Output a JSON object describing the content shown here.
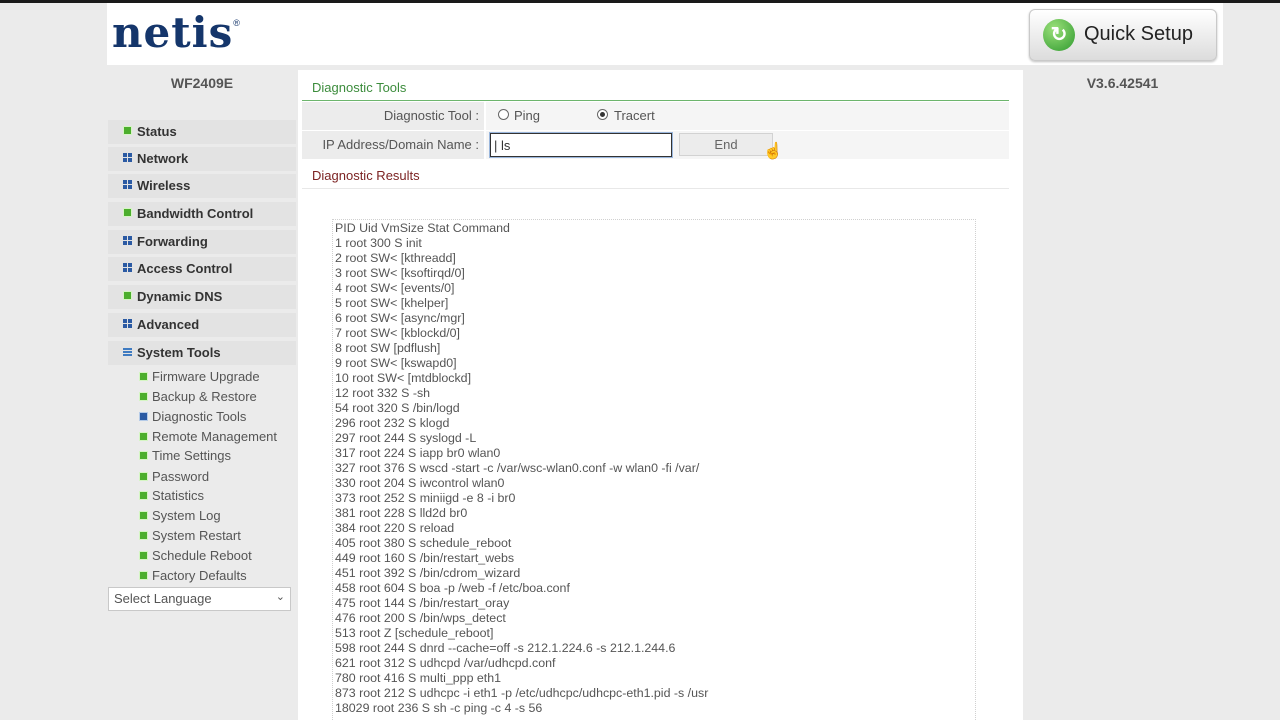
{
  "header": {
    "logo_text": "netis",
    "logo_mark": "®",
    "quick_setup_label": "Quick Setup",
    "quick_setup_icon": "refresh-arrow-icon"
  },
  "sidebar": {
    "model": "WF2409E",
    "nav_items": [
      {
        "label": "Status",
        "icon": "green-square-icon"
      },
      {
        "label": "Network",
        "icon": "grid-icon"
      },
      {
        "label": "Wireless",
        "icon": "grid-icon"
      },
      {
        "label": "Bandwidth Control",
        "icon": "green-square-icon"
      },
      {
        "label": "Forwarding",
        "icon": "grid-icon"
      },
      {
        "label": "Access Control",
        "icon": "grid-icon"
      },
      {
        "label": "Dynamic DNS",
        "icon": "green-square-icon"
      },
      {
        "label": "Advanced",
        "icon": "grid-icon"
      },
      {
        "label": "System Tools",
        "icon": "lines-icon",
        "expanded": true
      }
    ],
    "sub_items": [
      {
        "label": "Firmware Upgrade",
        "active": false
      },
      {
        "label": "Backup & Restore",
        "active": false
      },
      {
        "label": "Diagnostic Tools",
        "active": true
      },
      {
        "label": "Remote Management",
        "active": false
      },
      {
        "label": "Time Settings",
        "active": false
      },
      {
        "label": "Password",
        "active": false
      },
      {
        "label": "Statistics",
        "active": false
      },
      {
        "label": "System Log",
        "active": false
      },
      {
        "label": "System Restart",
        "active": false
      },
      {
        "label": "Schedule Reboot",
        "active": false
      },
      {
        "label": "Factory Defaults",
        "active": false
      }
    ],
    "language_select": "Select Language"
  },
  "main": {
    "title": "Diagnostic Tools",
    "tool_label": "Diagnostic Tool :",
    "ping_label": "Ping",
    "tracert_label": "Tracert",
    "selected_tool": "Tracert",
    "ip_label": "IP Address/Domain Name :",
    "ip_value": "| ls",
    "end_label": "End",
    "results_title": "Diagnostic Results",
    "results_lines": [
      "PID Uid VmSize Stat Command",
      "1 root 300 S init",
      "2 root SW< [kthreadd]",
      "3 root SW< [ksoftirqd/0]",
      "4 root SW< [events/0]",
      "5 root SW< [khelper]",
      "6 root SW< [async/mgr]",
      "7 root SW< [kblockd/0]",
      "8 root SW [pdflush]",
      "9 root SW< [kswapd0]",
      "10 root SW< [mtdblockd]",
      "12 root 332 S -sh",
      "54 root 320 S /bin/logd",
      "296 root 232 S klogd",
      "297 root 244 S syslogd -L",
      "317 root 224 S iapp br0 wlan0",
      "327 root 376 S wscd -start -c /var/wsc-wlan0.conf -w wlan0 -fi /var/",
      "330 root 204 S iwcontrol wlan0",
      "373 root 252 S miniigd -e 8 -i br0",
      "381 root 228 S lld2d br0",
      "384 root 220 S reload",
      "405 root 380 S schedule_reboot",
      "449 root 160 S /bin/restart_webs",
      "451 root 392 S /bin/cdrom_wizard",
      "458 root 604 S boa -p /web -f /etc/boa.conf",
      "475 root 144 S /bin/restart_oray",
      "476 root 200 S /bin/wps_detect",
      "513 root Z [schedule_reboot]",
      "598 root 244 S dnrd --cache=off -s 212.1.224.6 -s 212.1.244.6",
      "621 root 312 S udhcpd /var/udhcpd.conf",
      "780 root 416 S multi_ppp eth1",
      "873 root 212 S udhcpc -i eth1 -p /etc/udhcpc/udhcpc-eth1.pid -s /usr",
      "18029 root 236 S sh -c ping -c 4 -s 56"
    ]
  },
  "version": "V3.6.42541",
  "colors": {
    "accent_green": "#3c8c3c",
    "logo_navy": "#15366b",
    "results_title": "#7c2323"
  }
}
